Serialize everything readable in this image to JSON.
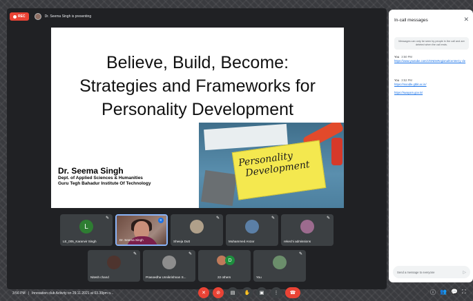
{
  "topbar": {
    "rec_label": "REC",
    "presenting_text": "Dr. Seema Singh is presenting"
  },
  "slide": {
    "title_lines": [
      "Believe, Build, Become:",
      "Strategies and Frameworks for",
      "Personality Development"
    ],
    "note_text_line1": "Personality",
    "note_text_line2": "Development",
    "speaker_name": "Dr. Seema Singh",
    "speaker_dept": "Dept. of Applied Sciences & Humanities",
    "speaker_inst": "Guru Tegh Bahadur Institute Of Technology"
  },
  "tiles": [
    {
      "name": "LE_005_Karanvir Singh",
      "letter": "L",
      "color": "#2e7d32",
      "kind": "letter"
    },
    {
      "name": "Dr. Seema Singh",
      "kind": "video"
    },
    {
      "name": "Sheeja Dutt",
      "kind": "photo",
      "color": "#b0a08a"
    },
    {
      "name": "Muhammed Anzar",
      "kind": "photo",
      "color": "#5b7fa6"
    },
    {
      "name": "rekechi admissions",
      "kind": "photo",
      "color": "#9c6b8e"
    },
    {
      "name": "Nitesh chand",
      "kind": "photo",
      "color": "#4e342e"
    },
    {
      "name": "Prasoedha Unnikrishnan S...",
      "kind": "photo",
      "color": "#8d8d8d"
    },
    {
      "name": "22 others",
      "kind": "others",
      "letter": "D",
      "color": "#1e8e3e"
    },
    {
      "name": "You",
      "kind": "photo",
      "color": "#6b8e6b"
    }
  ],
  "bottombar": {
    "time": "3:56 PM",
    "separator": "|",
    "meeting_title": "Innovation club Activity on 29.11.2021 at 03.30pm o..."
  },
  "controls": [
    {
      "icon": "mic-off-icon",
      "glyph": "✕"
    },
    {
      "icon": "camera-off-icon",
      "glyph": "⊘"
    },
    {
      "icon": "captions-icon",
      "glyph": "▤"
    },
    {
      "icon": "raise-hand-icon",
      "glyph": "✋"
    },
    {
      "icon": "present-icon",
      "glyph": "▣"
    },
    {
      "icon": "more-options-icon",
      "glyph": "⋮"
    },
    {
      "icon": "end-call-icon",
      "glyph": "☎"
    }
  ],
  "panel": {
    "title": "In-call messages",
    "close_glyph": "✕",
    "info_text": "Messages can only be seen by people in the call and are deleted when the call ends.",
    "messages": [
      {
        "sender": "You",
        "time": "3:50 PM",
        "links": [
          "https://www.youtube.com/c/GNDsRegionalCentreCy cle"
        ]
      },
      {
        "sender": "You",
        "time": "3:52 PM",
        "links": [
          "https://moodle.gtbit.ac.in/",
          "https://swayam.gov.in/"
        ]
      }
    ],
    "send_placeholder": "Send a message to everyone",
    "send_glyph": "▷"
  },
  "right_icons": [
    "ⓘ",
    "👥",
    "💬",
    "⛶"
  ]
}
